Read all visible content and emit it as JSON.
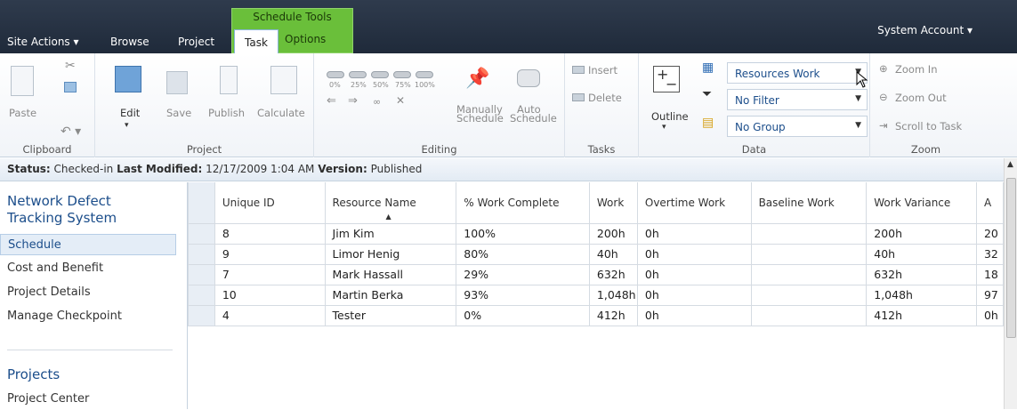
{
  "topbar": {
    "site_actions": "Site Actions ▾",
    "tabs": [
      "Browse",
      "Project"
    ],
    "context_group": "Schedule Tools",
    "active_tab": "Task",
    "options_tab": "Options",
    "account": "System Account ▾"
  },
  "ribbon": {
    "clipboard": {
      "paste": "Paste",
      "label": "Clipboard"
    },
    "project": {
      "edit": "Edit",
      "save": "Save",
      "publish": "Publish",
      "calculate": "Calculate",
      "label": "Project"
    },
    "editing": {
      "percents": [
        "0%",
        "25%",
        "50%",
        "75%",
        "100%"
      ],
      "manually": "Manually",
      "schedule1": "Schedule",
      "auto": "Auto",
      "schedule2": "Schedule",
      "label": "Editing"
    },
    "tasks": {
      "insert": "Insert",
      "delete": "Delete",
      "label": "Tasks"
    },
    "data": {
      "outline": "Outline",
      "view_select": "Resources Work",
      "filter_select": "No Filter",
      "group_select": "No Group",
      "label": "Data"
    },
    "zoom": {
      "zoom_in": "Zoom In",
      "zoom_out": "Zoom Out",
      "scroll": "Scroll to Task",
      "label": "Zoom"
    }
  },
  "status": {
    "status_label": "Status:",
    "status_value": "Checked-in",
    "modified_label": "Last Modified:",
    "modified_value": "12/17/2009 1:04 AM",
    "version_label": "Version:",
    "version_value": "Published"
  },
  "leftnav": {
    "heading1a": "Network Defect",
    "heading1b": "Tracking System",
    "items": [
      "Schedule",
      "Cost and Benefit",
      "Project Details",
      "Manage Checkpoint"
    ],
    "heading2": "Projects",
    "items2": [
      "Project Center"
    ]
  },
  "grid": {
    "columns": [
      "Unique ID",
      "Resource Name",
      "% Work Complete",
      "Work",
      "Overtime Work",
      "Baseline Work",
      "Work Variance",
      "A"
    ],
    "rows": [
      [
        "8",
        "Jim Kim",
        "100%",
        "200h",
        "0h",
        "",
        "200h",
        "20"
      ],
      [
        "9",
        "Limor Henig",
        "80%",
        "40h",
        "0h",
        "",
        "40h",
        "32"
      ],
      [
        "7",
        "Mark Hassall",
        "29%",
        "632h",
        "0h",
        "",
        "632h",
        "18"
      ],
      [
        "10",
        "Martin Berka",
        "93%",
        "1,048h",
        "0h",
        "",
        "1,048h",
        "97"
      ],
      [
        "4",
        "Tester",
        "0%",
        "412h",
        "0h",
        "",
        "412h",
        "0h"
      ]
    ]
  },
  "colors": {
    "topbar": "#2f3b4d",
    "context_tab": "#6abf3a",
    "link_blue": "#1c4e8b"
  }
}
